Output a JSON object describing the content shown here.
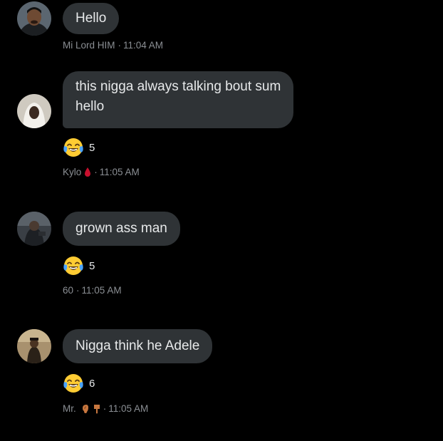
{
  "messages": [
    {
      "text": "Hello",
      "sender": "Mi Lord HIM",
      "time": "11:04 AM",
      "separator": "·"
    },
    {
      "text": "this nigga always talking bout sum\nhello",
      "reaction": {
        "icon": "tears-of-joy-emoji",
        "count": "5"
      },
      "sender": "Kylo",
      "sender_icon": "blood-drop-icon",
      "time": "11:05 AM",
      "separator": "·"
    },
    {
      "text": "grown ass man",
      "reaction": {
        "icon": "tears-of-joy-emoji",
        "count": "5"
      },
      "sender": "60",
      "time": "11:05 AM",
      "separator": "·"
    },
    {
      "text": "Nigga think he Adele",
      "reaction": {
        "icon": "tears-of-joy-emoji",
        "count": "6"
      },
      "sender": "Mr.",
      "sender_icons": [
        "ear-icon",
        "pointing-down-icon"
      ],
      "time": "11:05 AM",
      "separator": "·"
    }
  ],
  "colors": {
    "background": "#000000",
    "bubble": "#2f3336",
    "text": "#e7e9ea",
    "meta": "#8b8f94",
    "blood_drop": "#c8102e"
  }
}
